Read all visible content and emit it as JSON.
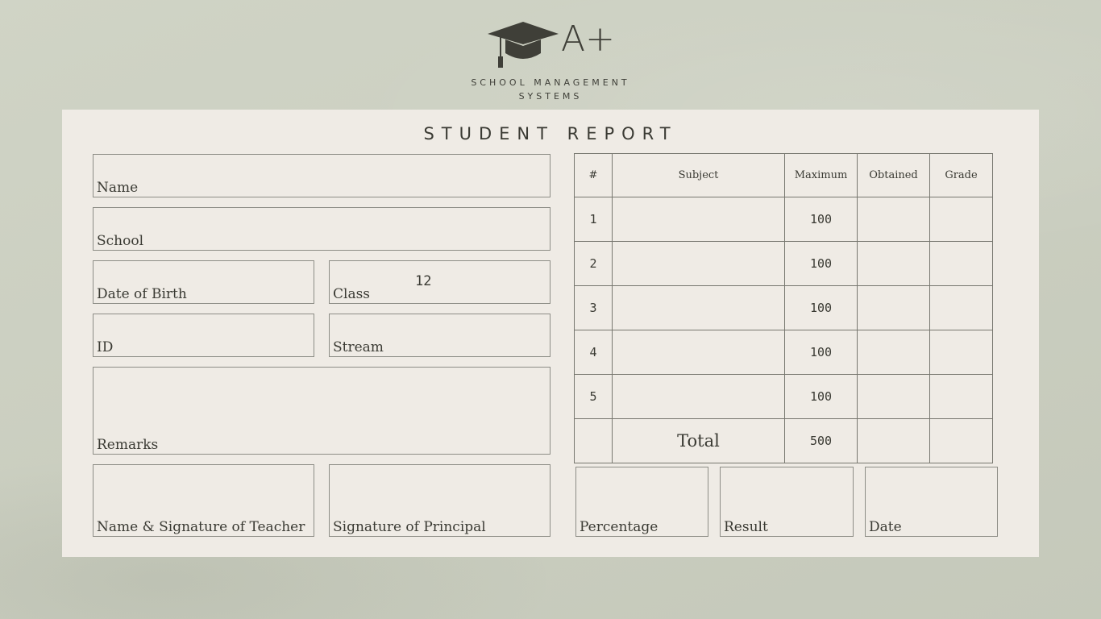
{
  "logo": {
    "grade": "A+",
    "line1": "SCHOOL MANAGEMENT",
    "line2": "SYSTEMS"
  },
  "report": {
    "title": "STUDENT REPORT",
    "fields": {
      "name": "Name",
      "school": "School",
      "dob": "Date of Birth",
      "class_label": "Class",
      "class_value": "12",
      "id": "ID",
      "stream": "Stream",
      "remarks": "Remarks",
      "teacher_sig": "Name & Signature of Teacher",
      "principal_sig": "Signature of Principal",
      "percentage": "Percentage",
      "result": "Result",
      "date": "Date"
    }
  },
  "table": {
    "headers": [
      "#",
      "Subject",
      "Maximum",
      "Obtained",
      "Grade"
    ],
    "rows": [
      {
        "num": "1",
        "subject": "",
        "max": "100",
        "obtained": "",
        "grade": ""
      },
      {
        "num": "2",
        "subject": "",
        "max": "100",
        "obtained": "",
        "grade": ""
      },
      {
        "num": "3",
        "subject": "",
        "max": "100",
        "obtained": "",
        "grade": ""
      },
      {
        "num": "4",
        "subject": "",
        "max": "100",
        "obtained": "",
        "grade": ""
      },
      {
        "num": "5",
        "subject": "",
        "max": "100",
        "obtained": "",
        "grade": ""
      }
    ],
    "total": {
      "label": "Total",
      "max": "500",
      "obtained": "",
      "grade": ""
    }
  },
  "colors": {
    "background": "#cdd1c2",
    "card": "#efebe5",
    "ink": "#3a3a33"
  },
  "icons": [
    "graduation-cap-icon"
  ]
}
